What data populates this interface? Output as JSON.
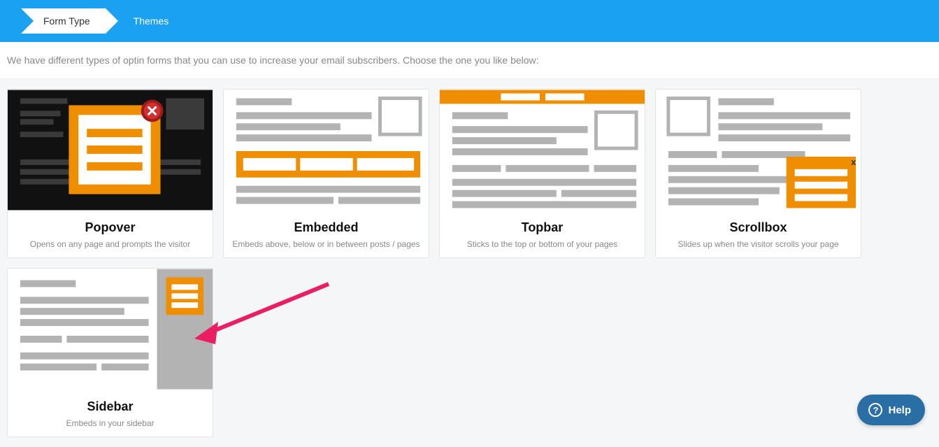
{
  "breadcrumb": {
    "step1": "Form Type",
    "step2": "Themes"
  },
  "intro": "We have different types of optin forms that you can use to increase your email subscribers. Choose the one you like below:",
  "cards": [
    {
      "title": "Popover",
      "desc": "Opens on any page and prompts the visitor"
    },
    {
      "title": "Embedded",
      "desc": "Embeds above, below or in between posts / pages"
    },
    {
      "title": "Topbar",
      "desc": "Sticks to the top or bottom of your pages"
    },
    {
      "title": "Scrollbox",
      "desc": "Slides up when the visitor scrolls your page"
    },
    {
      "title": "Sidebar",
      "desc": "Embeds in your sidebar"
    }
  ],
  "help": {
    "label": "Help"
  }
}
